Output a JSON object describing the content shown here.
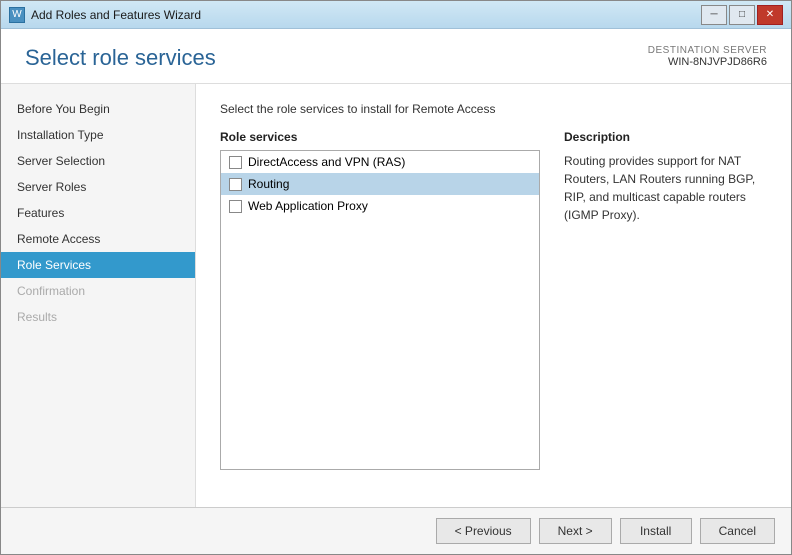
{
  "window": {
    "title": "Add Roles and Features Wizard",
    "icon": "W"
  },
  "titleButtons": {
    "minimize": "─",
    "maximize": "□",
    "close": "✕"
  },
  "header": {
    "title": "Select role services",
    "destinationLabel": "DESTINATION SERVER",
    "destinationName": "WIN-8NJVPJD86R6"
  },
  "instruction": "Select the role services to install for Remote Access",
  "sidebar": {
    "items": [
      {
        "label": "Before You Begin",
        "state": "normal"
      },
      {
        "label": "Installation Type",
        "state": "normal"
      },
      {
        "label": "Server Selection",
        "state": "normal"
      },
      {
        "label": "Server Roles",
        "state": "normal"
      },
      {
        "label": "Features",
        "state": "normal"
      },
      {
        "label": "Remote Access",
        "state": "normal"
      },
      {
        "label": "Role Services",
        "state": "active"
      },
      {
        "label": "Confirmation",
        "state": "disabled"
      },
      {
        "label": "Results",
        "state": "disabled"
      }
    ]
  },
  "roleServices": {
    "header": "Role services",
    "items": [
      {
        "label": "DirectAccess and VPN (RAS)",
        "checked": false,
        "selected": false
      },
      {
        "label": "Routing",
        "checked": false,
        "selected": true
      },
      {
        "label": "Web Application Proxy",
        "checked": false,
        "selected": false
      }
    ]
  },
  "description": {
    "header": "Description",
    "text": "Routing provides support for NAT Routers, LAN Routers running BGP, RIP, and multicast capable routers (IGMP Proxy)."
  },
  "footer": {
    "previousLabel": "< Previous",
    "nextLabel": "Next >",
    "installLabel": "Install",
    "cancelLabel": "Cancel"
  }
}
